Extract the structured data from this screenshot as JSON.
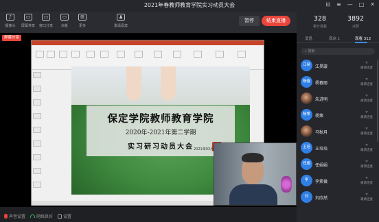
{
  "window": {
    "title": "2021年春教师教育学院实习动员大会",
    "controls": [
      "⊡",
      "≡",
      "—",
      "□",
      "✕"
    ]
  },
  "toolbar": {
    "items": [
      {
        "icon": "mic-icon",
        "glyph": "♪",
        "label": "摄像头"
      },
      {
        "icon": "screen-share-icon",
        "glyph": "▭",
        "label": "屏幕共享"
      },
      {
        "icon": "window-share-icon",
        "glyph": "▭",
        "label": "窗口分享"
      },
      {
        "icon": "whiteboard-icon",
        "glyph": "▭",
        "label": "白板"
      },
      {
        "icon": "more-icon",
        "glyph": "⊞",
        "label": "更多"
      },
      {
        "icon": "invite-icon",
        "glyph": "♟",
        "label": "邀请嘉宾"
      }
    ],
    "pause_label": "暂停",
    "end_label": "结束直播"
  },
  "share_tag": "屏幕分享",
  "slide": {
    "line1": "保定学院教师教育学院",
    "line2": "2020年-2021年第二学期",
    "line3": "实习研习动员大会",
    "date": "2021年03月05日"
  },
  "bottombar": {
    "mic_label": "声音设置",
    "network_label": "网络良好",
    "settings_label": "设置"
  },
  "stats": {
    "viewers": "328",
    "viewers_label": "累计观看",
    "likes": "3892",
    "likes_label": "点赞"
  },
  "tabs": [
    "消息",
    "观众 1",
    "观看 312"
  ],
  "search_placeholder": "搜索",
  "participants": [
    {
      "name": "江昊璇",
      "avatar": "江昊",
      "photo": false
    },
    {
      "name": "杨春丽",
      "avatar": "杨春",
      "photo": false
    },
    {
      "name": "朱进明",
      "avatar": "",
      "photo": true
    },
    {
      "name": "杨策",
      "avatar": "杨策",
      "photo": false
    },
    {
      "name": "马秋月",
      "avatar": "",
      "photo": true
    },
    {
      "name": "王培培",
      "avatar": "王培",
      "photo": false
    },
    {
      "name": "任娟娟",
      "avatar": "任娟",
      "photo": false
    },
    {
      "name": "李素薇",
      "avatar": "李",
      "photo": false
    },
    {
      "name": "刘欣然",
      "avatar": "刘",
      "photo": false
    }
  ],
  "participant_action": {
    "icon": "invite-mic-icon",
    "glyph": "ᯤ",
    "label": "邀请连麦"
  }
}
